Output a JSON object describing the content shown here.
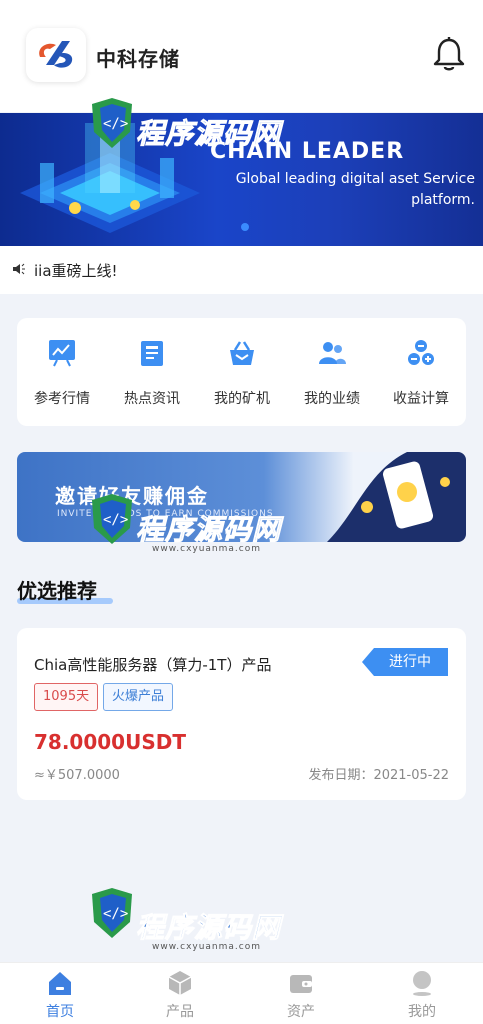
{
  "header": {
    "app_title": "中科存储"
  },
  "banner": {
    "headline": "CHAIN LEADER",
    "subtitle": "Global leading digital aset Service platform."
  },
  "notice": {
    "text": "iia重磅上线!"
  },
  "shortcuts": [
    {
      "label": "参考行情",
      "icon": "chart-board-icon"
    },
    {
      "label": "热点资讯",
      "icon": "news-icon"
    },
    {
      "label": "我的矿机",
      "icon": "basket-icon"
    },
    {
      "label": "我的业绩",
      "icon": "users-icon"
    },
    {
      "label": "收益计算",
      "icon": "calculator-icon"
    }
  ],
  "invite": {
    "title": "邀请好友赚佣金",
    "subtitle": "INVITE FRIENDS TO EARN COMMISSIONS"
  },
  "section": {
    "title": "优选推荐"
  },
  "product": {
    "name": "Chia高性能服务器（算力-1T）产品",
    "status": "进行中",
    "tags": [
      "1095天",
      "火爆产品"
    ],
    "price": "78.0000USDT",
    "approx": "≈￥507.0000",
    "date_label": "发布日期：2021-05-22"
  },
  "tabbar": [
    {
      "label": "首页",
      "icon": "home-icon",
      "active": true
    },
    {
      "label": "产品",
      "icon": "box-icon",
      "active": false
    },
    {
      "label": "资产",
      "icon": "wallet-icon",
      "active": false
    },
    {
      "label": "我的",
      "icon": "profile-icon",
      "active": false
    }
  ],
  "watermark": {
    "text": "程序源码网",
    "url": "www.cxyuanma.com"
  },
  "colors": {
    "accent": "#3d7fe0",
    "price": "#d8302f",
    "banner": "#1a45c9"
  }
}
